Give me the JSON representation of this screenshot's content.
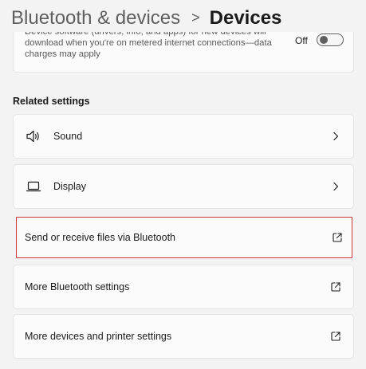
{
  "header": {
    "parent": "Bluetooth & devices",
    "separator": ">",
    "current": "Devices"
  },
  "download_setting": {
    "description": "Device software (drivers, info, and apps) for new devices will download when you're on metered internet connections—data charges may apply",
    "toggle_state": "Off"
  },
  "related": {
    "title": "Related settings",
    "items": [
      {
        "label": "Sound",
        "icon": "speaker-icon",
        "trailing": "chevron-right-icon"
      },
      {
        "label": "Display",
        "icon": "laptop-icon",
        "trailing": "chevron-right-icon"
      },
      {
        "label": "Send or receive files via Bluetooth",
        "icon": "",
        "trailing": "open-external-icon",
        "highlighted": true
      },
      {
        "label": "More Bluetooth settings",
        "icon": "",
        "trailing": "open-external-icon"
      },
      {
        "label": "More devices and printer settings",
        "icon": "",
        "trailing": "open-external-icon"
      }
    ]
  },
  "colors": {
    "background": "#f3f3f3",
    "card": "#fbfbfb",
    "highlight_border": "#d13438"
  }
}
